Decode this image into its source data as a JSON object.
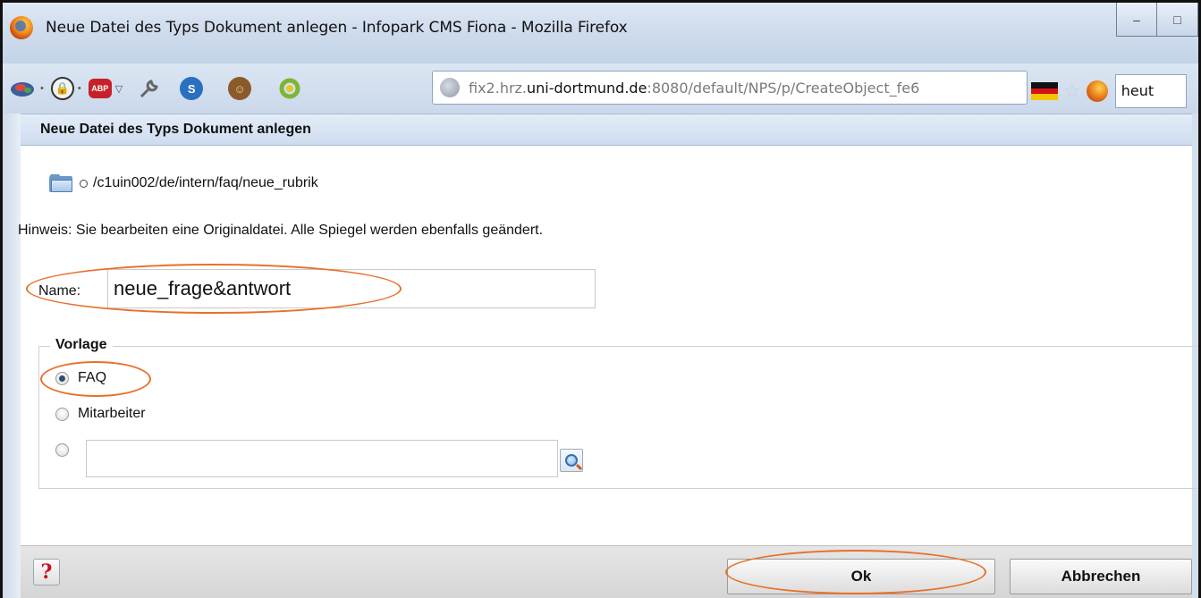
{
  "window": {
    "title": "Neue Datei des Typs Dokument anlegen - Infopark CMS Fiona - Mozilla Firefox",
    "minimize_glyph": "–",
    "maximize_glyph": "□"
  },
  "toolbar": {
    "addon_s_label": "S",
    "abp_label": "ABP"
  },
  "urlbar": {
    "url_prefix": "fix2.hrz.",
    "url_domain": "uni-dortmund.de",
    "url_suffix": ":8080/default/NPS/p/CreateObject_fe6",
    "search_peek": "heut"
  },
  "dialog": {
    "title": "Neue Datei des Typs Dokument anlegen",
    "path": "/c1uin002/de/intern/faq/neue_rubrik",
    "hint": "Hinweis: Sie bearbeiten eine Originaldatei. Alle Spiegel werden ebenfalls geändert.",
    "name_label": "Name:",
    "name_value": "neue_frage&antwort",
    "template_legend": "Vorlage",
    "templates": [
      {
        "label": "FAQ",
        "checked": true
      },
      {
        "label": "Mitarbeiter",
        "checked": false
      },
      {
        "label": "",
        "checked": false
      }
    ],
    "template_custom_value": ""
  },
  "footer": {
    "help_glyph": "?",
    "ok_label": "Ok",
    "cancel_label": "Abbrechen"
  },
  "colors": {
    "annotation_oval": "#e8702a",
    "header_gradient_top": "#e4edf8",
    "radio_checked": "#2e4d73"
  }
}
